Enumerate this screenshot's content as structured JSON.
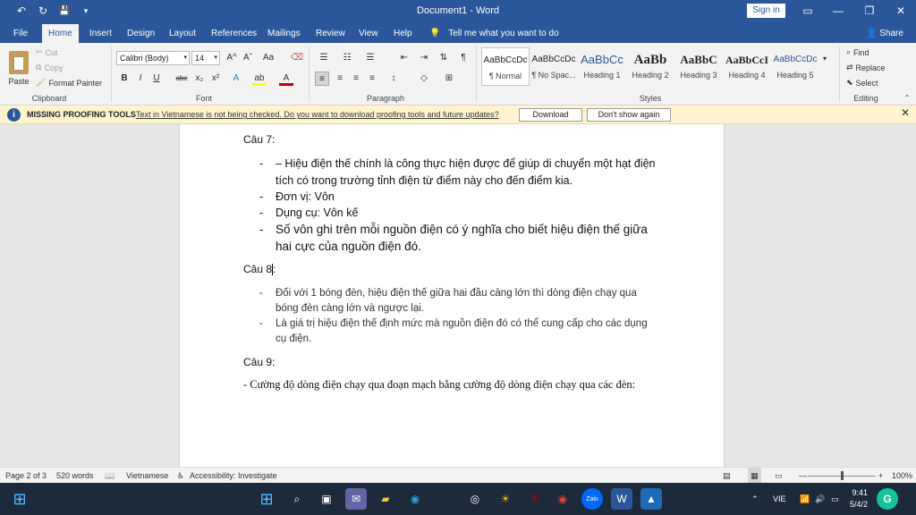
{
  "titlebar": {
    "title": "Document1  -  Word",
    "sign_in": "Sign in",
    "undo_icon": "↶",
    "redo_icon": "↻",
    "save_icon": "💾",
    "more_icon": "▾",
    "ribbon_display_icon": "▭",
    "minimize_icon": "—",
    "restore_icon": "❐",
    "close_icon": "✕"
  },
  "tabs": [
    {
      "label": "File"
    },
    {
      "label": "Home"
    },
    {
      "label": "Insert"
    },
    {
      "label": "Design"
    },
    {
      "label": "Layout"
    },
    {
      "label": "References"
    },
    {
      "label": "Mailings"
    },
    {
      "label": "Review"
    },
    {
      "label": "View"
    },
    {
      "label": "Help"
    }
  ],
  "tell_me": "Tell me what you want to do",
  "share": "Share",
  "ribbon": {
    "clipboard": {
      "paste": "Paste",
      "cut": "Cut",
      "copy": "Copy",
      "format_painter": "Format Painter",
      "label": "Clipboard"
    },
    "font": {
      "family": "Calibri (Body)",
      "size": "14",
      "label": "Font",
      "bold": "B",
      "italic": "I",
      "underline": "U",
      "strike": "abc",
      "subscript": "x₂",
      "superscript": "x²",
      "grow": "A^",
      "shrink": "Aˇ",
      "case": "Aa",
      "effects": "A",
      "highlight": "ab",
      "color": "A"
    },
    "paragraph": {
      "label": "Paragraph"
    },
    "styles": {
      "label": "Styles",
      "items": [
        {
          "preview": "AaBbCcDc",
          "name": "¶ Normal"
        },
        {
          "preview": "AaBbCcDc",
          "name": "¶ No Spac..."
        },
        {
          "preview": "AaBbCc",
          "name": "Heading 1"
        },
        {
          "preview": "AaBb",
          "name": "Heading 2"
        },
        {
          "preview": "AaBbC",
          "name": "Heading 3"
        },
        {
          "preview": "AaBbCcI",
          "name": "Heading 4"
        },
        {
          "preview": "AaBbCcDc",
          "name": "Heading 5"
        }
      ]
    },
    "editing": {
      "label": "Editing",
      "find": "Find",
      "replace": "Replace",
      "select": "Select"
    }
  },
  "message_bar": {
    "title": "MISSING PROOFING TOOLS",
    "text": "Text in Vietnamese is not being checked. Do you want to download proofing tools and future updates?",
    "download": "Download",
    "dont_show": "Don't show again"
  },
  "document": {
    "q7": "Câu 7:",
    "q7_items": [
      "– Hiệu điện thế chính là công thực hiện được để giúp di chuyển một hạt điện tích có trong trường tỉnh điện từ điểm này cho đến điểm kia.",
      "Đơn vị: Vôn",
      "Dụng cụ: Vôn kế",
      "Số vôn ghi trên mỗi nguồn điện có ý nghĩa cho biết hiệu điện thế giữa hai cực của nguồn điện đó."
    ],
    "q8": "Câu 8",
    "q8_colon": ":",
    "q8_items": [
      " Đối với 1 bóng đèn, hiệu điện thế giữa hai đầu càng lớn thì dòng điện chạy qua bóng đèn càng lớn và ngược lại.",
      " Là giá trị hiệu điện thế định mức mà nguồn điện đó có thể cung cấp cho các dụng cụ điện."
    ],
    "q9": "Câu 9:",
    "q9_text": "- Cường độ dòng điện chạy qua đoạn mạch bằng cường độ dòng điện chạy qua các đèn:"
  },
  "status": {
    "page": "Page 2 of 3",
    "words": "520 words",
    "language": "Vietnamese",
    "accessibility": "Accessibility: Investigate",
    "zoom_minus": "—",
    "zoom_plus": "+",
    "zoom": "100%",
    "zoom_fraction": 0.5
  },
  "taskbar": {
    "language": "VIE",
    "time": "9:41",
    "date": "5/4/2",
    "grammarly": "G"
  }
}
